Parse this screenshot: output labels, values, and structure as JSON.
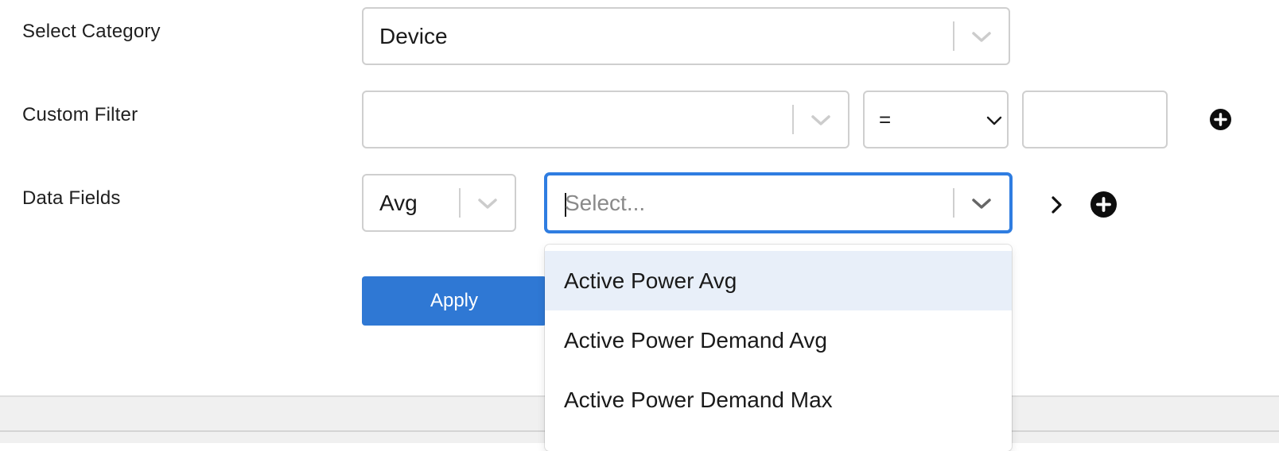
{
  "labels": {
    "select_category": "Select Category",
    "custom_filter": "Custom Filter",
    "data_fields": "Data Fields"
  },
  "category_select": {
    "value": "Device"
  },
  "custom_filter": {
    "field_value": "",
    "operator_value": "=",
    "text_value": ""
  },
  "data_fields": {
    "aggregate_value": "Avg",
    "field_placeholder": "Select...",
    "options": [
      "Active Power Avg",
      "Active Power Demand Avg",
      "Active Power Demand Max"
    ],
    "highlighted_index": 0
  },
  "buttons": {
    "apply_label": "Apply"
  },
  "icons": {
    "add": "plus-circle-icon",
    "next": "chevron-right-icon",
    "dropdown": "chevron-down-icon"
  },
  "colors": {
    "accent": "#2f78d4",
    "focus_border": "#2f7de1",
    "option_highlight": "#e8eff9"
  }
}
